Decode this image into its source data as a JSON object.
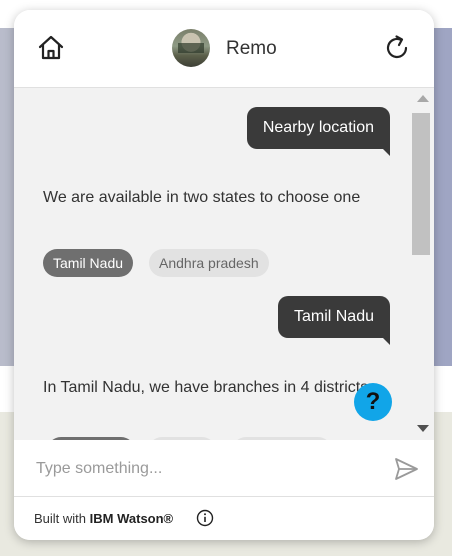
{
  "header": {
    "bot_name": "Remo",
    "home_icon": "home-icon",
    "refresh_icon": "refresh-icon"
  },
  "messages": [
    {
      "from": "user",
      "text": "Nearby location"
    },
    {
      "from": "bot",
      "text": "We are available in two states to choose one",
      "options": [
        {
          "label": "Tamil Nadu",
          "selected": true
        },
        {
          "label": "Andhra pradesh",
          "selected": false
        }
      ]
    },
    {
      "from": "user",
      "text": "Tamil Nadu"
    },
    {
      "from": "bot",
      "text": "In Tamil Nadu, we have branches in 4 districts"
    }
  ],
  "help_button": {
    "label": "?"
  },
  "input": {
    "placeholder": "Type something...",
    "value": ""
  },
  "footer": {
    "built_with": "Built with",
    "brand": "IBM Watson®"
  },
  "colors": {
    "user_bubble": "#3a3a3a",
    "help_button": "#11a5e8",
    "chip_selected": "#6f6f6f",
    "chip_unselected": "#e2e2e2"
  }
}
